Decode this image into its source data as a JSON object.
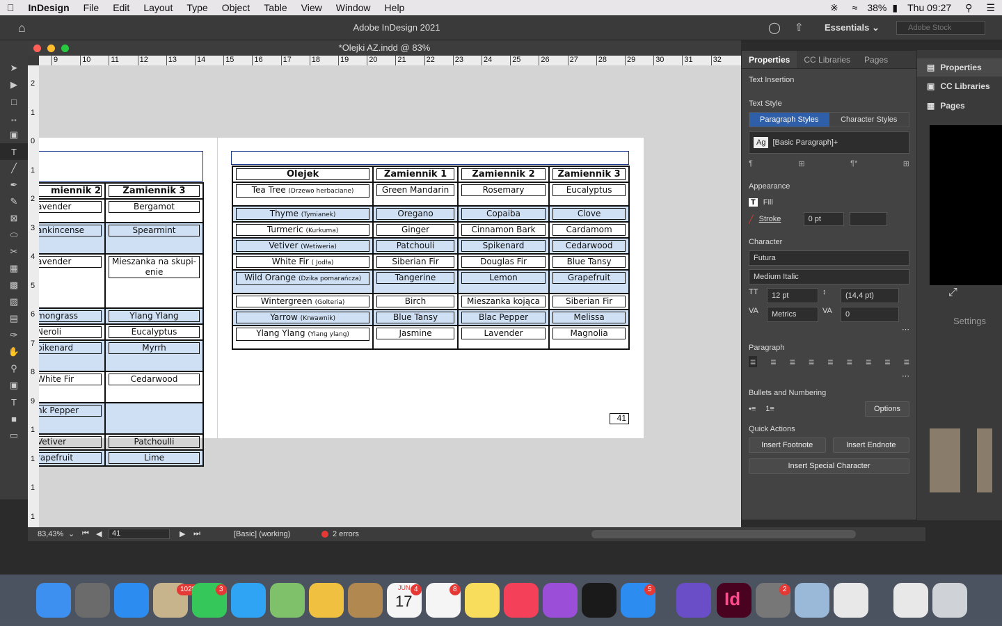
{
  "menubar": {
    "app": "InDesign",
    "items": [
      "File",
      "Edit",
      "Layout",
      "Type",
      "Object",
      "Table",
      "View",
      "Window",
      "Help"
    ],
    "battery": "38%",
    "clock": "Thu 09:27"
  },
  "app_header": {
    "title": "Adobe InDesign 2021",
    "workspace": "Essentials",
    "stock_placeholder": "Adobe Stock"
  },
  "document": {
    "tab_title": "*Olejki AZ.indd @ 83%",
    "ruler_top": [
      "9",
      "10",
      "11",
      "12",
      "13",
      "14",
      "15",
      "16",
      "17",
      "18",
      "19",
      "20",
      "21",
      "22",
      "23",
      "24",
      "25",
      "26",
      "27",
      "28",
      "29",
      "30",
      "31",
      "32"
    ],
    "ruler_left": [
      "2",
      "1",
      "0",
      "1",
      "2",
      "3",
      "4",
      "5",
      "6",
      "7",
      "8",
      "9",
      "1",
      "1",
      "1",
      "1"
    ],
    "page_number": "41"
  },
  "left_table": {
    "headers": [
      "miennik 2",
      "Zamiennik 3"
    ],
    "rows": [
      [
        "avender",
        "Bergamot"
      ],
      [
        "ankincense",
        "Spearmint"
      ],
      [
        "avender",
        "Mieszanka na skupi-enie"
      ],
      [
        "mongrass",
        "Ylang Ylang"
      ],
      [
        "Neroli",
        "Eucalyptus"
      ],
      [
        "pikenard",
        "Myrrh"
      ],
      [
        "White Fir",
        "Cedarwood"
      ],
      [
        "nk Pepper",
        ""
      ],
      [
        "Vetiver",
        "Patchoulli"
      ],
      [
        "rapefruit",
        "Lime"
      ]
    ]
  },
  "main_table": {
    "headers": [
      "Olejek",
      "Zamiennik 1",
      "Zamiennik 2",
      "Zamiennik 3"
    ],
    "rows": [
      {
        "name": "Tea Tree",
        "sub": "(Drzewo herbaciane)",
        "z1": "Green Mandarin",
        "z2": "Rosemary",
        "z3": "Eucalyptus"
      },
      {
        "name": "Thyme",
        "sub": "(Tymianek)",
        "z1": "Oregano",
        "z2": "Copaiba",
        "z3": "Clove"
      },
      {
        "name": "Turmeric",
        "sub": "(Kurkuma)",
        "z1": "Ginger",
        "z2": "Cinnamon Bark",
        "z3": "Cardamom"
      },
      {
        "name": "Vetiver",
        "sub": "(Wetiweria)",
        "z1": "Patchouli",
        "z2": "Spikenard",
        "z3": "Cedarwood"
      },
      {
        "name": "White Fir",
        "sub": "( Jodła)",
        "z1": "Siberian Fir",
        "z2": "Douglas Fir",
        "z3": "Blue Tansy"
      },
      {
        "name": "Wild Orange",
        "sub": "(Dzika pomarańcza)",
        "z1": "Tangerine",
        "z2": "Lemon",
        "z3": "Grapefruit"
      },
      {
        "name": "Wintergreen",
        "sub": "(Golteria)",
        "z1": "Birch",
        "z2": "Mieszanka kojąca",
        "z3": "Siberian Fir"
      },
      {
        "name": "Yarrow",
        "sub": "(Krwawnik)",
        "z1": "Blue Tansy",
        "z2": "Blac Pepper",
        "z3": "Melissa"
      },
      {
        "name": "Ylang Ylang",
        "sub": "(Ylang ylang)",
        "z1": "Jasmine",
        "z2": "Lavender",
        "z3": "Magnolia"
      }
    ]
  },
  "statusbar": {
    "zoom": "83,43%",
    "page": "41",
    "style": "[Basic] (working)",
    "errors": "2 errors"
  },
  "properties": {
    "tabs": [
      "Properties",
      "CC Libraries",
      "Pages"
    ],
    "text_insertion": "Text Insertion",
    "text_style": "Text Style",
    "style_tabs": [
      "Paragraph Styles",
      "Character Styles"
    ],
    "paragraph_style": "[Basic Paragraph]+",
    "appearance": "Appearance",
    "fill": "Fill",
    "stroke": "Stroke",
    "stroke_weight": "0 pt",
    "character": "Character",
    "font": "Futura",
    "font_style": "Medium Italic",
    "size": "12 pt",
    "leading": "(14,4 pt)",
    "kerning": "Metrics",
    "tracking": "0",
    "paragraph": "Paragraph",
    "bullets": "Bullets and Numbering",
    "options": "Options",
    "quick_actions": "Quick Actions",
    "insert_footnote": "Insert Footnote",
    "insert_endnote": "Insert Endnote",
    "insert_special": "Insert Special Character"
  },
  "right_panel": {
    "items": [
      "Properties",
      "CC Libraries",
      "Pages"
    ],
    "settings": "Settings"
  },
  "dock": {
    "badges": {
      "mail": "1028",
      "facetime": "3",
      "calendar": "4",
      "reminders": "8",
      "appstore": "5",
      "settings": "2"
    },
    "calendar_month": "JUN",
    "calendar_day": "17"
  }
}
